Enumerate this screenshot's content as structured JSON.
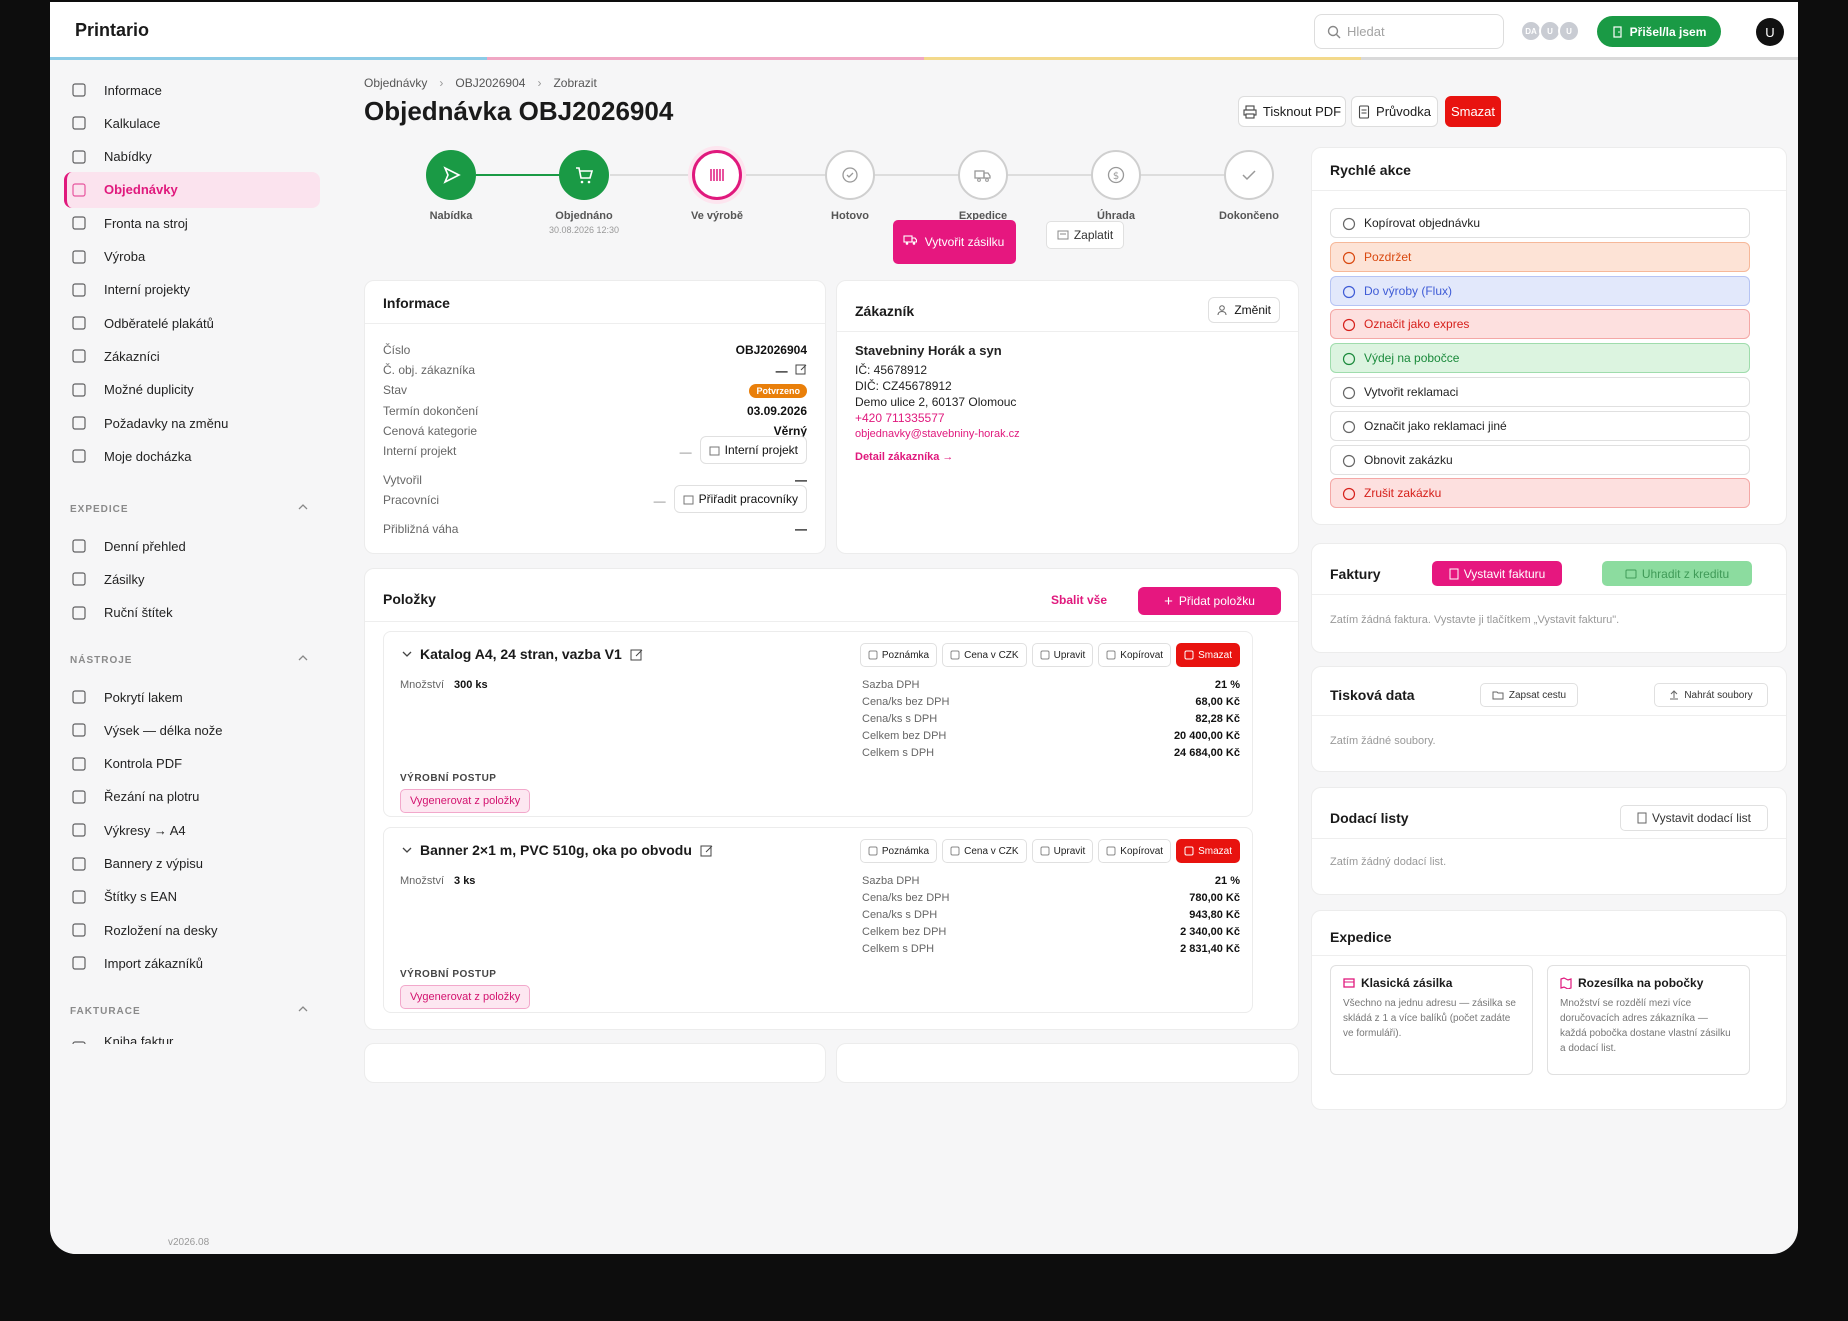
{
  "app": {
    "brand": "Printario"
  },
  "header": {
    "search_placeholder": "Hledat",
    "avatars": [
      "DA",
      "U",
      "U"
    ],
    "checkin": "Přišel/la jsem",
    "user": "U"
  },
  "sidebar": {
    "items": [
      "Informace",
      "Kalkulace",
      "Nabídky",
      "Objednávky",
      "Fronta na stroj",
      "Výroba",
      "Interní projekty",
      "Odběratelé plakátů",
      "Zákazníci",
      "Možné duplicity",
      "Požadavky na změnu",
      "Moje docházka"
    ],
    "expedice_label": "EXPEDICE",
    "expedice_items": [
      "Denní přehled",
      "Zásilky",
      "Ruční štítek"
    ],
    "nastroje_label": "NÁSTROJE",
    "nastroje_items": [
      "Pokrytí lakem",
      "Výsek — délka nože",
      "Kontrola PDF",
      "Řezání na plotru",
      "Výkresy → A4",
      "Bannery z výpisu",
      "Štítky s EAN",
      "Rozložení na desky",
      "Import zákazníků"
    ],
    "fakturace_label": "FAKTURACE",
    "fakturace_partial": "Kniha faktur",
    "version": "v2026.08"
  },
  "breadcrumb": [
    "Objednávky",
    "OBJ2026904",
    "Zobrazit"
  ],
  "page_title": "Objednávka OBJ2026904",
  "actions": {
    "print": "Tisknout PDF",
    "guide": "Průvodka",
    "delete": "Smazat"
  },
  "stepper": [
    {
      "label": "Nabídka",
      "state": "done",
      "icon": "send-icon"
    },
    {
      "label": "Objednáno",
      "state": "done",
      "icon": "cart-icon",
      "sub": "30.08.2026 12:30"
    },
    {
      "label": "Ve výrobě",
      "state": "current",
      "icon": "barcode-icon"
    },
    {
      "label": "Hotovo",
      "state": "todo",
      "icon": "check-circle-icon"
    },
    {
      "label": "Expedice",
      "state": "todo",
      "icon": "truck-icon"
    },
    {
      "label": "Úhrada",
      "state": "todo",
      "icon": "dollar-icon"
    },
    {
      "label": "Dokončeno",
      "state": "todo",
      "icon": "check-icon"
    }
  ],
  "step_actions": {
    "create_shipment": "Vytvořit zásilku",
    "pay": "Zaplatit"
  },
  "info": {
    "title": "Informace",
    "rows": [
      {
        "k": "Číslo",
        "v": "OBJ2026904"
      },
      {
        "k": "Č. obj. zákazníka",
        "v": "—"
      },
      {
        "k": "Stav",
        "v": "Potvrzeno"
      },
      {
        "k": "Termín dokončení",
        "v": "03.09.2026"
      },
      {
        "k": "Cenová kategorie",
        "v": "Věrný"
      },
      {
        "k": "Interní projekt",
        "v": "Interní projekt"
      },
      {
        "k": "Vytvořil",
        "v": "—"
      },
      {
        "k": "Pracovníci",
        "v": "Přiřadit pracovníky"
      },
      {
        "k": "Přibližná váha",
        "v": "—"
      }
    ]
  },
  "customer": {
    "title": "Zákazník",
    "change": "Změnit",
    "name": "Stavebniny Horák a syn",
    "ic": "IČ: 45678912",
    "dic": "DIČ: CZ45678912",
    "address": "Demo ulice 2, 60137 Olomouc",
    "phone": "+420 711335577",
    "email": "objednavky@stavebniny-horak.cz",
    "detail": "Detail zákazníka →"
  },
  "items_panel": {
    "title": "Položky",
    "collapse": "Sbalit vše",
    "add": "Přidat položku"
  },
  "item_buttons": {
    "note": "Poznámka",
    "price": "Cena v CZK",
    "edit": "Upravit",
    "copy": "Kopírovat",
    "delete": "Smazat"
  },
  "items": [
    {
      "name": "Katalog A4, 24 stran, vazba V1",
      "qty_label": "Množství",
      "qty": "300 ks",
      "rows": [
        [
          "Sazba DPH",
          "21 %"
        ],
        [
          "Cena/ks bez DPH",
          "68,00 Kč"
        ],
        [
          "Cena/ks s DPH",
          "82,28 Kč"
        ],
        [
          "Celkem bez DPH",
          "20 400,00 Kč"
        ],
        [
          "Celkem s DPH",
          "24 684,00 Kč"
        ]
      ],
      "prod_label": "VÝROBNÍ POSTUP",
      "prod_btn": "Vygenerovat z položky"
    },
    {
      "name": "Banner 2×1 m, PVC 510g, oka po obvodu",
      "qty_label": "Množství",
      "qty": "3 ks",
      "rows": [
        [
          "Sazba DPH",
          "21 %"
        ],
        [
          "Cena/ks bez DPH",
          "780,00 Kč"
        ],
        [
          "Cena/ks s DPH",
          "943,80 Kč"
        ],
        [
          "Celkem bez DPH",
          "2 340,00 Kč"
        ],
        [
          "Celkem s DPH",
          "2 831,40 Kč"
        ]
      ],
      "prod_label": "VÝROBNÍ POSTUP",
      "prod_btn": "Vygenerovat z položky"
    }
  ],
  "quick": {
    "title": "Rychlé akce",
    "actions": [
      {
        "label": "Kopírovat objednávku",
        "tone": "plain"
      },
      {
        "label": "Pozdržet",
        "tone": "orange"
      },
      {
        "label": "Do výroby (Flux)",
        "tone": "blue"
      },
      {
        "label": "Označit jako expres",
        "tone": "red"
      },
      {
        "label": "Výdej na pobočce",
        "tone": "green"
      },
      {
        "label": "Vytvořit reklamaci",
        "tone": "plain"
      },
      {
        "label": "Označit jako reklamaci jiné",
        "tone": "plain"
      },
      {
        "label": "Obnovit zakázku",
        "tone": "plain"
      },
      {
        "label": "Zrušit zakázku",
        "tone": "red"
      }
    ]
  },
  "invoices": {
    "title": "Faktury",
    "issue": "Vystavit fakturu",
    "credit": "Uhradit z kreditu",
    "empty": "Zatím žádná faktura. Vystavte ji tlačítkem „Vystavit fakturu\"."
  },
  "print_data": {
    "title": "Tisková data",
    "path": "Zapsat cestu",
    "upload": "Nahrát soubory",
    "empty": "Zatím žádné soubory."
  },
  "delivery": {
    "title": "Dodací listy",
    "issue": "Vystavit dodací list",
    "empty": "Zatím žádný dodací list."
  },
  "shipping": {
    "title": "Expedice",
    "options": [
      {
        "title": "Klasická zásilka",
        "desc": "Všechno na jednu adresu — zásilka se skládá z 1 a více balíků (počet zadáte ve formuláři)."
      },
      {
        "title": "Rozesílka na pobočky",
        "desc": "Množství se rozdělí mezi více doručovacích adres zákazníka — každá pobočka dostane vlastní zásilku a dodací list."
      }
    ]
  },
  "colors": {
    "accent": "#e0197d",
    "green": "#1a9a45",
    "red": "#e8130f",
    "orange": "#e97f0a"
  }
}
